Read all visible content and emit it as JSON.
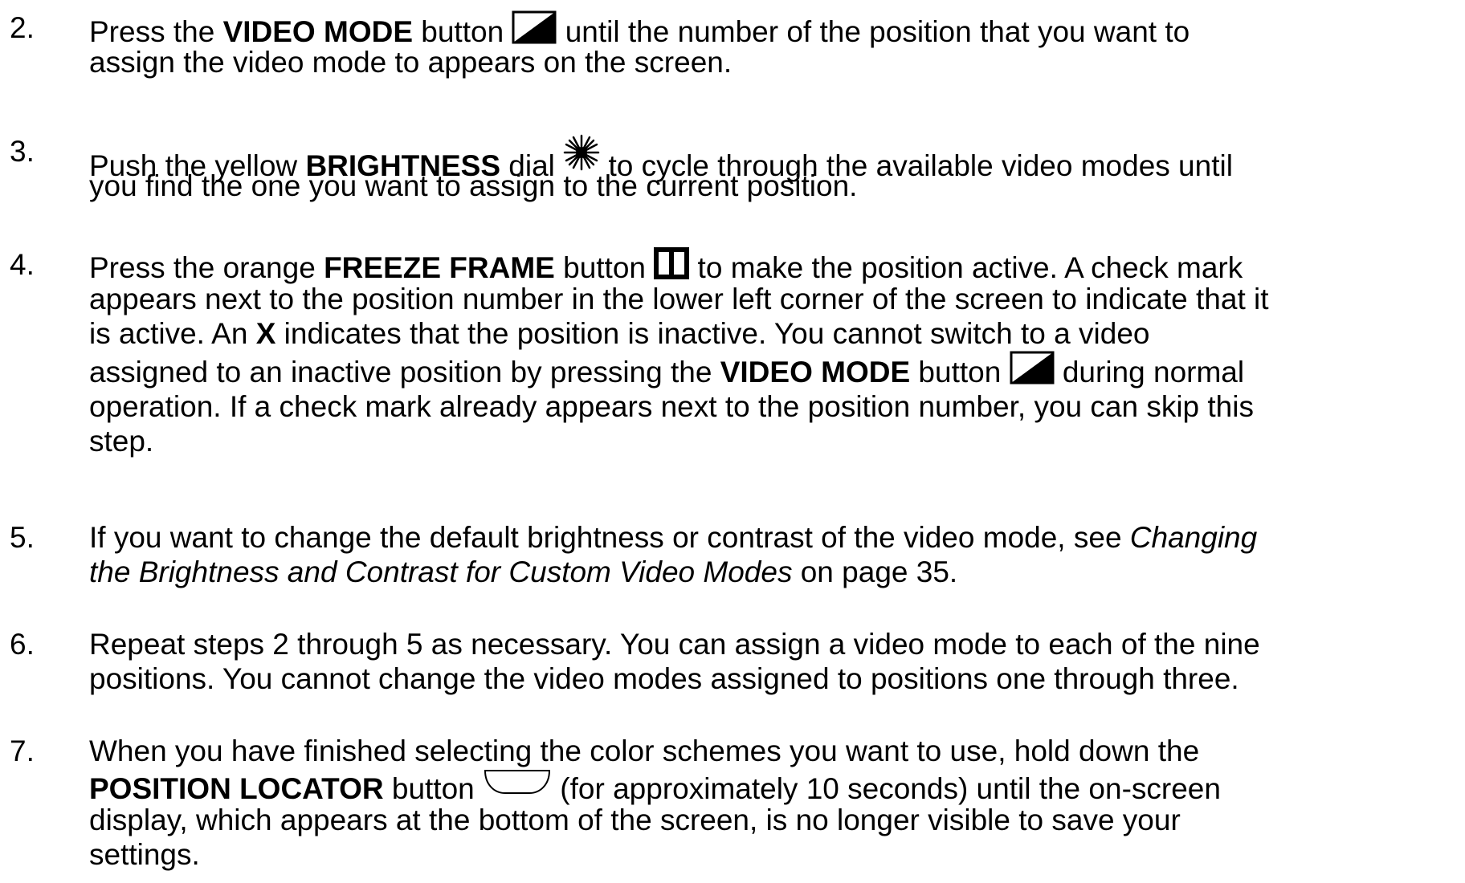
{
  "steps": [
    {
      "number": "2.",
      "parts": {
        "a": "Press the ",
        "b": "VIDEO MODE",
        "c": " button ",
        "d": " until the number of the position that you want to",
        "e": "assign the video mode to appears on the screen."
      },
      "icons": [
        "video-mode-icon"
      ]
    },
    {
      "number": "3.",
      "parts": {
        "a": "Push the yellow ",
        "b": "BRIGHTNESS",
        "c": " dial ",
        "d": " to cycle through the available video modes until",
        "e": "you find the one you want to assign to the current position."
      },
      "icons": [
        "brightness-icon"
      ]
    },
    {
      "number": "4.",
      "parts": {
        "a": "Press the orange ",
        "b": "FREEZE FRAME",
        "c": " button ",
        "d": " to make the position active. A check mark",
        "e": "appears next to the position number in the lower left corner of the screen to indicate that it",
        "f": "is active. An ",
        "g": "X",
        "h": " indicates that the position is inactive. You cannot switch to a video",
        "i": "assigned to an inactive position by pressing the ",
        "j": "VIDEO MODE",
        "k": " button ",
        "l": " during normal",
        "m": "operation. If a check mark already appears next to the position number, you can skip this",
        "n": "step."
      },
      "icons": [
        "freeze-frame-icon",
        "video-mode-icon"
      ]
    },
    {
      "number": "5.",
      "parts": {
        "a": "If you want to change the default brightness or contrast of the video mode, see ",
        "b": "Changing",
        "c": "the Brightness and Contrast for Custom Video Modes",
        "d": " on page 35."
      }
    },
    {
      "number": "6.",
      "parts": {
        "a": "Repeat steps 2 through 5 as necessary. You can assign a video mode to each of the nine",
        "b": "positions. You cannot change the video modes assigned to positions one through three."
      }
    },
    {
      "number": "7.",
      "parts": {
        "a": "When you have finished selecting the color schemes you want to use, hold down the",
        "b": "POSITION LOCATOR",
        "c": " button ",
        "d": " (for approximately 10 seconds) until the on-screen",
        "e": "display, which appears at the bottom of the screen, is no longer visible to save your",
        "f": "settings."
      },
      "icons": [
        "position-locator-icon"
      ]
    }
  ]
}
